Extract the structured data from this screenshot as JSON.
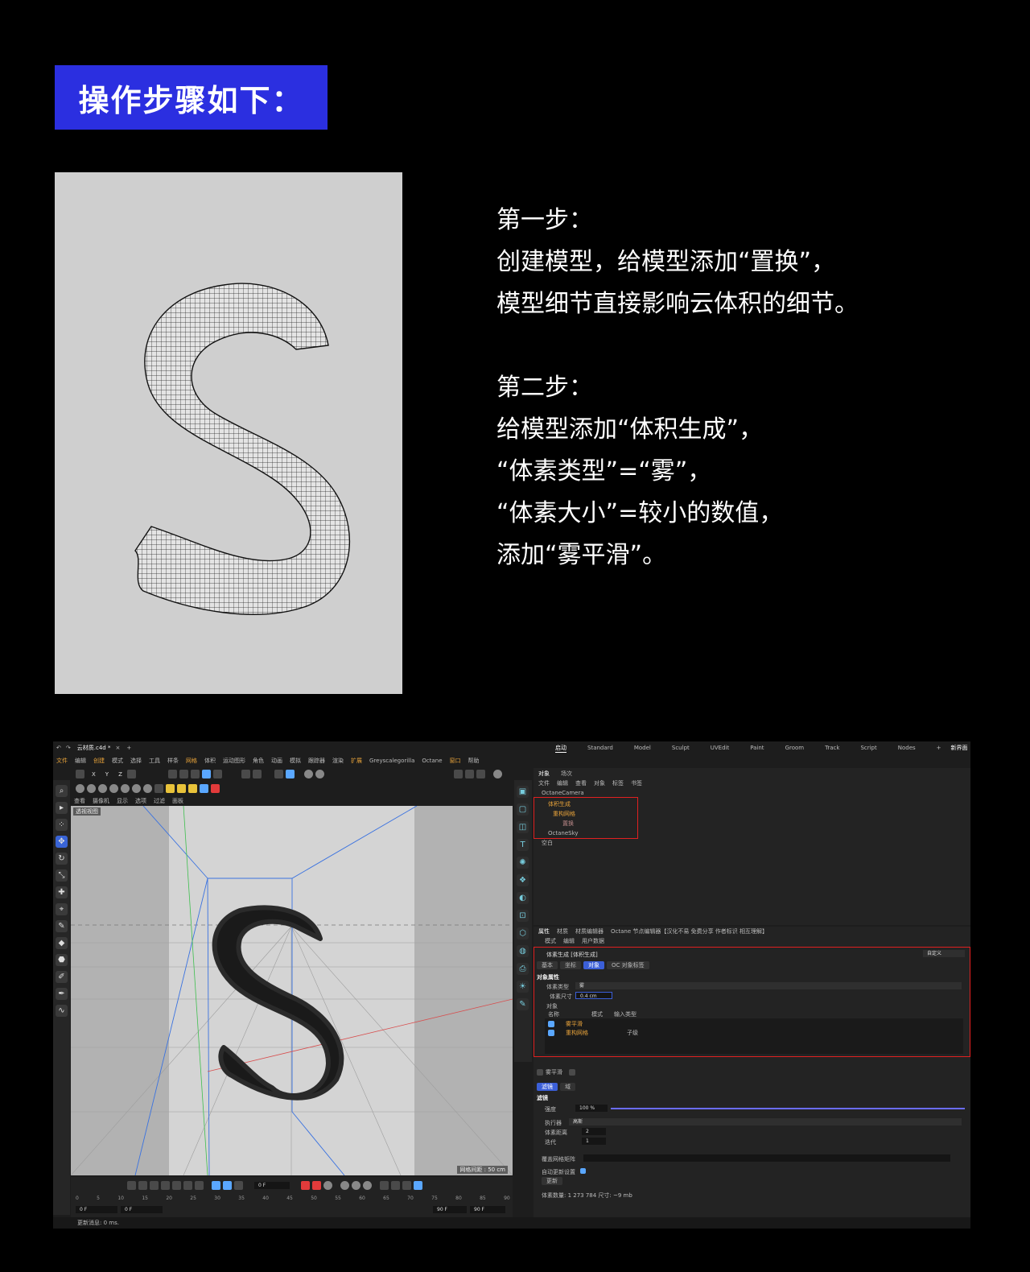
{
  "banner": {
    "title": "操作步骤如下："
  },
  "steps": [
    {
      "heading": "第一步：",
      "lines": [
        "创建模型，给模型添加“置换”，",
        "模型细节直接影响云体积的细节。"
      ]
    },
    {
      "heading": "第二步：",
      "lines": [
        "给模型添加“体积生成”，",
        "“体素类型”=“雾”，",
        "“体素大小”=较小的数值，",
        "添加“雾平滑”。"
      ]
    }
  ],
  "app": {
    "document_tab": "云材质.c4d *",
    "menu": [
      "文件",
      "编辑",
      "创建",
      "模式",
      "选择",
      "工具",
      "样条",
      "网格",
      "体积",
      "运动图形",
      "角色",
      "动画",
      "模拟",
      "跟踪器",
      "渲染",
      "扩展",
      "Greyscalegorilla",
      "Octane",
      "窗口",
      "帮助"
    ],
    "workspaces": [
      "启动",
      "Standard",
      "Model",
      "Sculpt",
      "UVEdit",
      "Paint",
      "Groom",
      "Track",
      "Script",
      "Nodes"
    ],
    "new_interface": "新界面",
    "axes": [
      "X",
      "Y",
      "Z"
    ],
    "viewport_menu": [
      "查看",
      "摄像机",
      "显示",
      "选项",
      "过滤",
      "面板"
    ],
    "viewport_label": "透视视图",
    "grid_spacing": "网格间距 : 50 cm",
    "timeline": {
      "frame_current": "0 F",
      "ticks": [
        "0",
        "5",
        "10",
        "15",
        "20",
        "25",
        "30",
        "35",
        "40",
        "45",
        "50",
        "55",
        "60",
        "65",
        "70",
        "75",
        "80",
        "85",
        "90"
      ],
      "start_a": "0 F",
      "start_b": "0 F",
      "end_a": "90 F",
      "end_b": "90 F"
    },
    "status_text": "更新消息: 0 ms.",
    "object_manager": {
      "tabs": [
        "对象",
        "场次"
      ],
      "menu": [
        "文件",
        "编辑",
        "查看",
        "对象",
        "标签",
        "书签"
      ],
      "items": [
        "OctaneCamera",
        "体积生成",
        "重构网格",
        "置换",
        "OctaneSky",
        "空白"
      ]
    },
    "attribute_manager": {
      "tabs": [
        "属性",
        "材质",
        "材质编辑器",
        "Octane 节点编辑器【汉化不易 免费分享 作者标识 相互理解】"
      ],
      "menu": [
        "模式",
        "编辑",
        "用户数据"
      ],
      "object_title": "体素生成 [体积生成]",
      "preset": "自定义",
      "sub_tabs": [
        "基本",
        "坐标",
        "对象",
        "OC 对象标签"
      ],
      "section": "对象属性",
      "voxel_type_label": "体素类型",
      "voxel_type_value": "雾",
      "voxel_size_label": "体素尺寸",
      "voxel_size_value": "0.4 cm",
      "objects_label": "对象",
      "cols": [
        "名称",
        "模式",
        "输入类型"
      ],
      "rows": [
        {
          "name": "雾平滑",
          "mode": "",
          "type": ""
        },
        {
          "name": "重构网格",
          "mode": "",
          "type": "子级"
        }
      ],
      "filter_name": "雾平滑",
      "filter_tabs": [
        "滤镜",
        "域"
      ],
      "filter_section": "滤镜",
      "strength_label": "强度",
      "strength_value": "100 %",
      "strength_fraction": 1.0,
      "executor_label": "执行器",
      "executor_value": "高斯",
      "voxel_dist_label": "体素距离",
      "voxel_dist_value": "2",
      "iter_label": "迭代",
      "iter_value": "1",
      "mask_label": "覆盖网格矩阵",
      "auto_update_label": "自动更新设置",
      "update_button": "更新",
      "info": "体素数量: 1 273 784   尺寸: ~9 mb"
    }
  },
  "colors": {
    "banner": "#2b2fe0",
    "highlight": "#e02020",
    "accent": "#3b5fd8"
  }
}
